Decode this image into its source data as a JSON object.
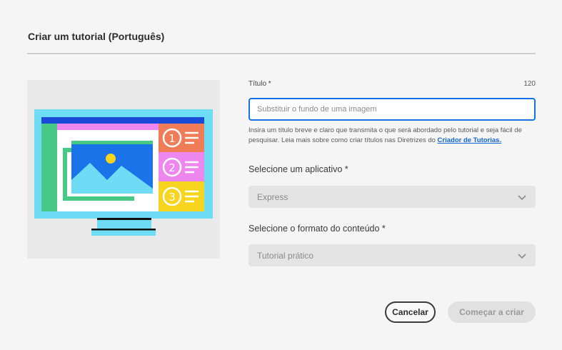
{
  "dialog": {
    "title": "Criar um tutorial (Português)"
  },
  "form": {
    "title_label": "Título *",
    "title_counter": "120",
    "title_placeholder": "Substituir o fundo de uma imagem",
    "help_text": "Insira um título breve e claro que transmita o que será abordado pelo tutorial e seja fácil de pesquisar. Leia mais sobre como criar títulos nas Diretrizes do",
    "help_link": "Criador de Tutorias.",
    "app_label": "Selecione um aplicativo *",
    "app_value": "Express",
    "format_label": "Selecione o formato do conteúdo *",
    "format_value": "Tutorial prático"
  },
  "illustration": {
    "steps": [
      "1",
      "2",
      "3"
    ]
  },
  "buttons": {
    "cancel": "Cancelar",
    "start": "Começar a criar"
  },
  "colors": {
    "accent_blue": "#1473e6",
    "monitor_cyan": "#6fdcf5",
    "step1": "#f07b57",
    "step2": "#ee86f0",
    "step3": "#f7d51e",
    "green": "#46c985"
  }
}
